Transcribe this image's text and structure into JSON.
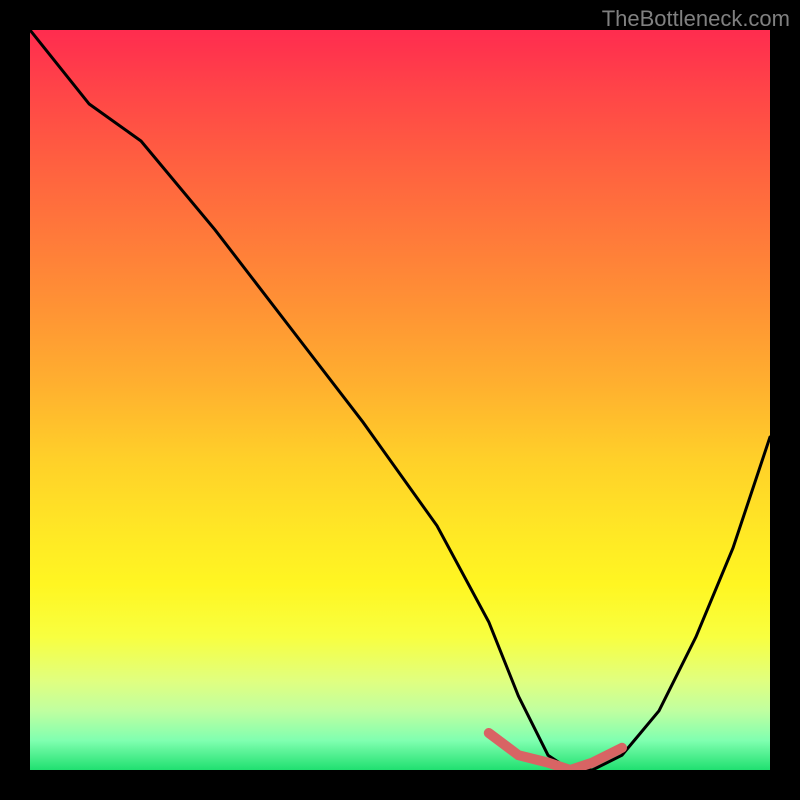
{
  "watermark": "TheBottleneck.com",
  "chart_data": {
    "type": "line",
    "title": "",
    "xlabel": "",
    "ylabel": "",
    "xlim": [
      0,
      100
    ],
    "ylim": [
      0,
      100
    ],
    "series": [
      {
        "name": "bottleneck-curve",
        "x": [
          0,
          8,
          15,
          25,
          35,
          45,
          55,
          62,
          66,
          70,
          73,
          76,
          80,
          85,
          90,
          95,
          100
        ],
        "values": [
          100,
          90,
          85,
          73,
          60,
          47,
          33,
          20,
          10,
          2,
          0,
          0,
          2,
          8,
          18,
          30,
          45
        ]
      }
    ],
    "highlight_segment": {
      "name": "optimal-range",
      "x": [
        62,
        66,
        70,
        73,
        76,
        80
      ],
      "values": [
        5,
        2,
        1,
        0,
        1,
        3
      ]
    },
    "gradient_stops": [
      {
        "pos": 0,
        "color": "#ff2c4f"
      },
      {
        "pos": 50,
        "color": "#ffd029"
      },
      {
        "pos": 80,
        "color": "#fff622"
      },
      {
        "pos": 100,
        "color": "#20e070"
      }
    ]
  }
}
